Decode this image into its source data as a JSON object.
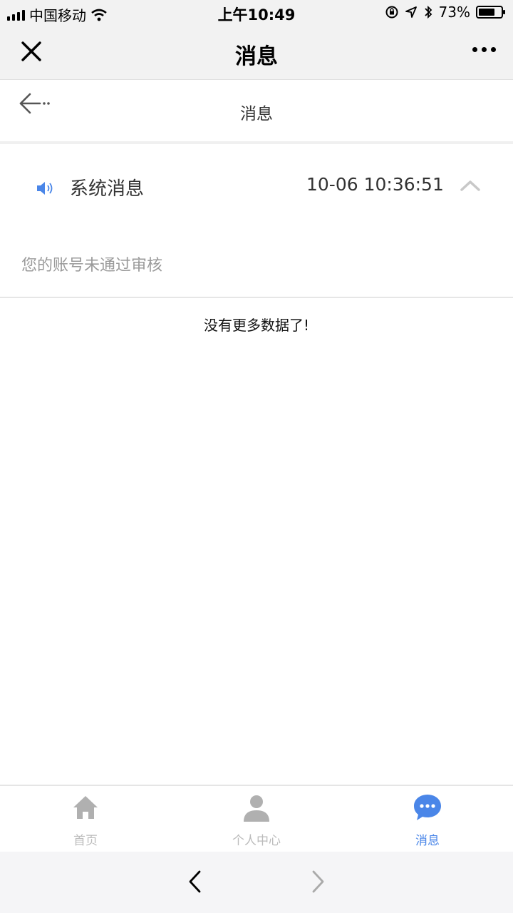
{
  "status_bar": {
    "carrier": "中国移动",
    "time": "上午10:49",
    "battery_percent_label": "73%",
    "battery_level": 0.73
  },
  "nav": {
    "title": "消息"
  },
  "page_header": {
    "title": "消息"
  },
  "message": {
    "title": "系统消息",
    "time": "10-06 10:36:51",
    "body": "您的账号未通过审核"
  },
  "list_footer": "没有更多数据了!",
  "tabs": [
    {
      "label": "首页",
      "icon": "home-icon",
      "active": false
    },
    {
      "label": "个人中心",
      "icon": "person-icon",
      "active": false
    },
    {
      "label": "消息",
      "icon": "chat-bubble-icon",
      "active": true
    }
  ],
  "colors": {
    "accent": "#4a86e8",
    "tab_inactive": "#bbbbbb",
    "muted_text": "#9a9a9a"
  }
}
